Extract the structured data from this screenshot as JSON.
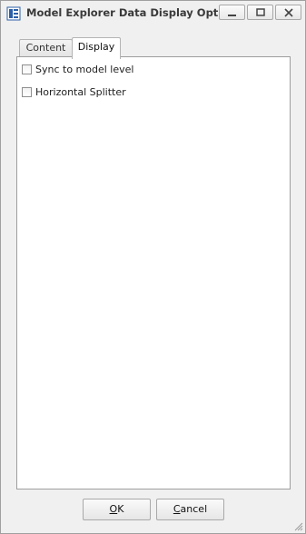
{
  "window": {
    "title": "Model Explorer Data Display Options",
    "controls": {
      "minimize_icon": "minimize-icon",
      "maximize_icon": "maximize-icon",
      "close_icon": "close-icon"
    }
  },
  "tabs": [
    {
      "label": "Content",
      "active": false
    },
    {
      "label": "Display",
      "active": true
    }
  ],
  "options": [
    {
      "label": "Sync to model level",
      "checked": false
    },
    {
      "label": "Horizontal Splitter",
      "checked": false
    }
  ],
  "buttons": {
    "ok": {
      "accel": "O",
      "rest": "K"
    },
    "cancel": {
      "accel": "C",
      "rest": "ancel"
    }
  },
  "colors": {
    "window_bg": "#f0f0f0",
    "panel_bg": "#ffffff",
    "border": "#a0a0a0",
    "icon_blue": "#2b5fa8"
  }
}
